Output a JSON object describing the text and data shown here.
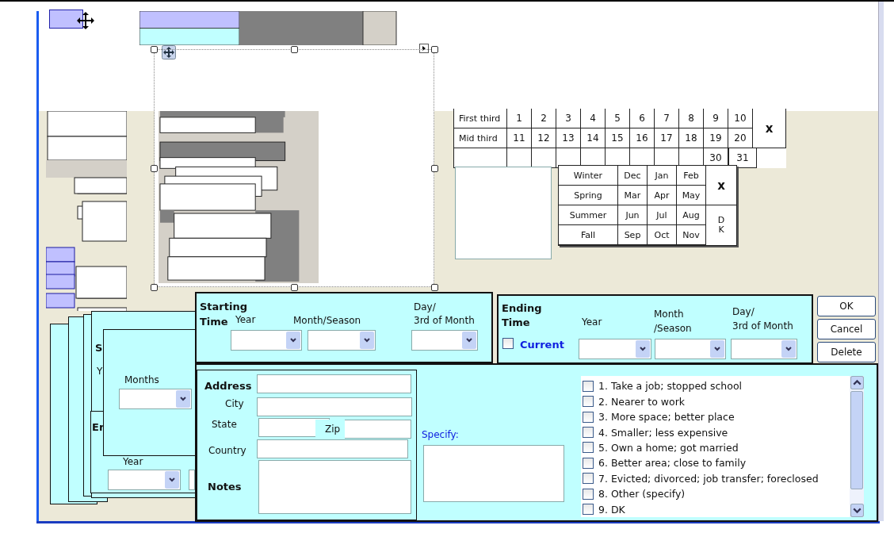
{
  "day_grid": {
    "rows": [
      {
        "label": "First third",
        "days": [
          "1",
          "2",
          "3",
          "4",
          "5",
          "6",
          "7",
          "8",
          "9",
          "10"
        ]
      },
      {
        "label": "Mid third",
        "days": [
          "11",
          "12",
          "13",
          "14",
          "15",
          "16",
          "17",
          "18",
          "19",
          "20"
        ]
      }
    ],
    "last_row_days": [
      "30",
      "31"
    ],
    "clear": "x"
  },
  "season_grid": {
    "rows": [
      {
        "season": "Winter",
        "months": [
          "Dec",
          "Jan",
          "Feb"
        ]
      },
      {
        "season": "Spring",
        "months": [
          "Mar",
          "Apr",
          "May"
        ]
      },
      {
        "season": "Summer",
        "months": [
          "Jun",
          "Jul",
          "Aug"
        ]
      },
      {
        "season": "Fall",
        "months": [
          "Sep",
          "Oct",
          "Nov"
        ]
      }
    ],
    "clear": "x",
    "dont_know": "DK"
  },
  "back_form": {
    "heading": "S",
    "label": "Y",
    "heading_2": "Er",
    "year_label": "Year"
  },
  "months_panel": {
    "label": "Months"
  },
  "starting_time": {
    "title": "Starting",
    "title_2": "Time",
    "year_label": "Year",
    "month_label": "Month/Season",
    "day_label": "Day/",
    "day_label_2": "3rd of Month"
  },
  "ending_time": {
    "title": "Ending",
    "title_2": "Time",
    "current": {
      "label": "Current",
      "checked": false
    },
    "year_label": "Year",
    "month_label": "Month",
    "month_label_2": "/Season",
    "day_label": "Day/",
    "day_label_2": "3rd of Month"
  },
  "buttons": [
    "OK",
    "Cancel",
    "Delete"
  ],
  "address": {
    "address_label": "Address",
    "city_label": "City",
    "state_label": "State",
    "zip_label": "Zip",
    "country_label": "Country",
    "notes_label": "Notes"
  },
  "specify": {
    "label": "Specify:"
  },
  "reasons": [
    {
      "label": "1. Take a job; stopped school",
      "checked": false
    },
    {
      "label": "2. Nearer to work",
      "checked": false
    },
    {
      "label": "3. More space; better place",
      "checked": false
    },
    {
      "label": "4. Smaller; less expensive",
      "checked": false
    },
    {
      "label": "5. Own a home; got married",
      "checked": false
    },
    {
      "label": "6. Better area; close to family",
      "checked": false
    },
    {
      "label": "7. Evicted; divorced; job transfer; foreclosed",
      "checked": false
    },
    {
      "label": "8. Other (specify)",
      "checked": false
    },
    {
      "label": "9. DK",
      "checked": false
    }
  ]
}
